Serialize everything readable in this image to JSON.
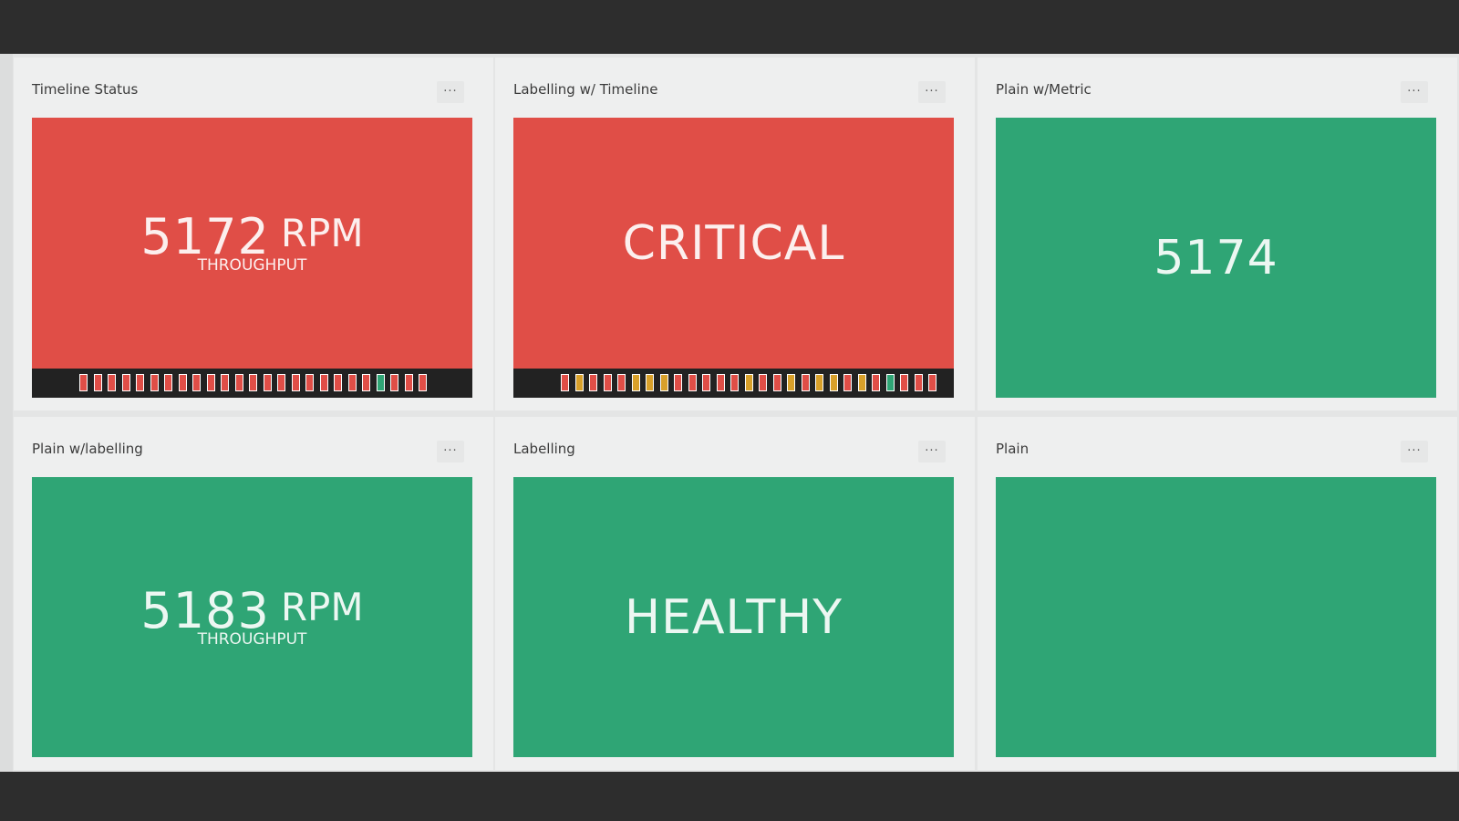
{
  "colors": {
    "critical": "#e04e47",
    "healthy": "#2fa575",
    "warning": "#d8a02a",
    "timeline_bg": "#222222"
  },
  "panels": [
    {
      "title": "Timeline Status",
      "menu_label": "...",
      "status": "critical",
      "metric_value": "5172",
      "metric_unit": "RPM",
      "metric_label": "THROUGHPUT",
      "timeline": [
        "critical",
        "critical",
        "critical",
        "critical",
        "critical",
        "critical",
        "critical",
        "critical",
        "critical",
        "critical",
        "critical",
        "critical",
        "critical",
        "critical",
        "critical",
        "critical",
        "critical",
        "critical",
        "critical",
        "critical",
        "critical",
        "healthy",
        "critical",
        "critical",
        "critical"
      ]
    },
    {
      "title": "Labelling w/ Timeline",
      "menu_label": "...",
      "status": "critical",
      "text": "CRITICAL",
      "timeline": [
        "critical",
        "warning",
        "critical",
        "critical",
        "critical",
        "warning",
        "warning",
        "warning",
        "critical",
        "critical",
        "critical",
        "critical",
        "critical",
        "warning",
        "critical",
        "critical",
        "warning",
        "critical",
        "warning",
        "warning",
        "critical",
        "warning",
        "critical",
        "healthy",
        "critical",
        "critical",
        "critical"
      ]
    },
    {
      "title": "Plain w/Metric",
      "menu_label": "...",
      "status": "healthy",
      "metric_value": "5174"
    },
    {
      "title": "Plain w/labelling",
      "menu_label": "...",
      "status": "healthy",
      "metric_value": "5183",
      "metric_unit": "RPM",
      "metric_label": "THROUGHPUT"
    },
    {
      "title": "Labelling",
      "menu_label": "...",
      "status": "healthy",
      "text": "HEALTHY"
    },
    {
      "title": "Plain",
      "menu_label": "...",
      "status": "healthy"
    }
  ]
}
